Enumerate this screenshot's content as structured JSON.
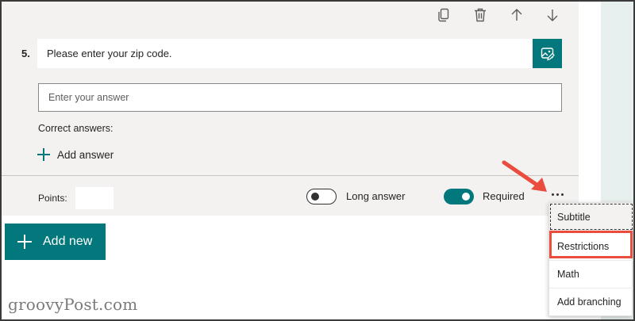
{
  "question": {
    "number": "5.",
    "text": "Please enter your zip code.",
    "answer_placeholder": "Enter your answer",
    "correct_answers_label": "Correct answers:",
    "add_answer_label": "Add answer",
    "points_label": "Points:",
    "points_value": ""
  },
  "toolbar": {
    "icons": [
      "copy-icon",
      "trash-icon",
      "arrow-up-icon",
      "arrow-down-icon"
    ]
  },
  "toggles": {
    "long_answer": {
      "label": "Long answer",
      "on": false
    },
    "required": {
      "label": "Required",
      "on": true
    }
  },
  "add_new_label": "Add new",
  "context_menu": {
    "items": [
      "Subtitle",
      "Restrictions",
      "Math",
      "Add branching"
    ],
    "highlighted": "Restrictions"
  },
  "watermark": "groovyPost.com",
  "colors": {
    "accent": "#03787c",
    "card_background": "#f3f2f1",
    "annotation_red": "#ea4c3e"
  }
}
